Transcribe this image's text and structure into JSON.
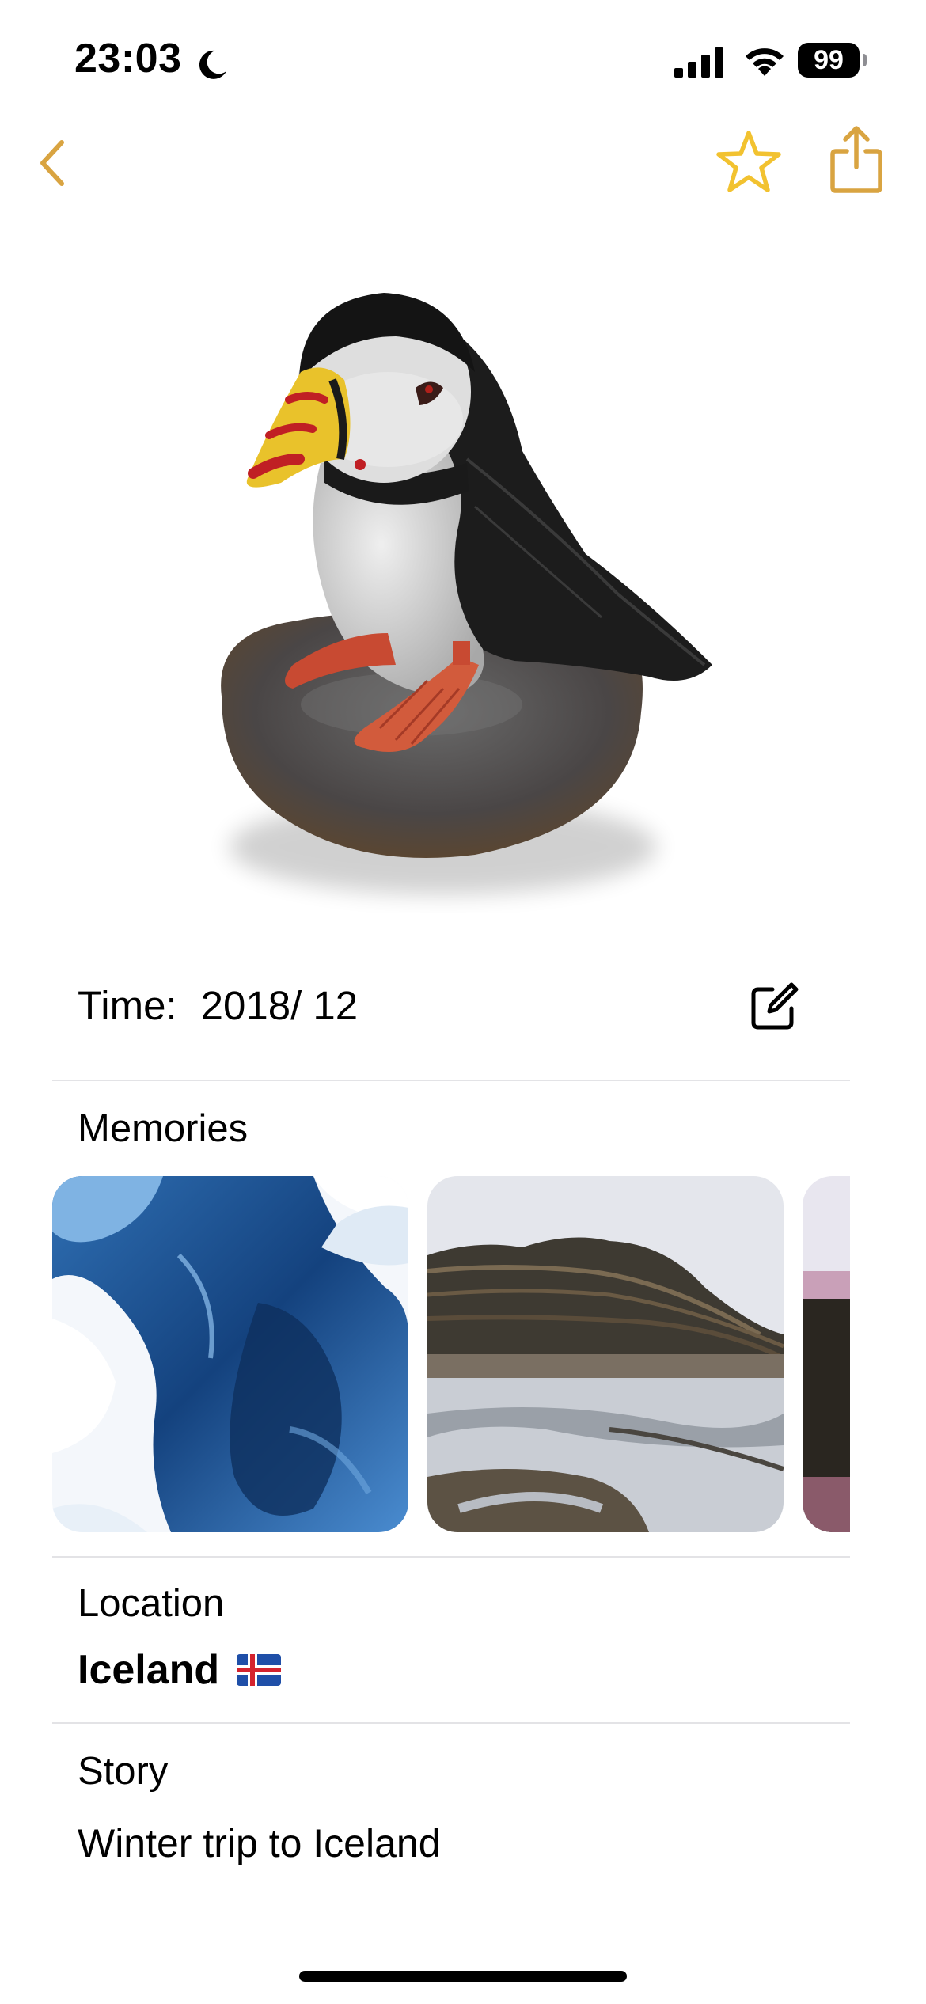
{
  "status_bar": {
    "time": "23:03",
    "battery": "99"
  },
  "nav": {
    "accent_color": "#D9A441",
    "star_color": "#F2C230"
  },
  "item": {
    "time_label": "Time:",
    "time_value": "2018/ 12"
  },
  "memories": {
    "title": "Memories",
    "cards": [
      "ice-cave-photo",
      "mountain-landscape-photo",
      "sunset-landscape-photo"
    ]
  },
  "location": {
    "title": "Location",
    "value": "Iceland"
  },
  "story": {
    "title": "Story",
    "value": "Winter trip to Iceland"
  }
}
